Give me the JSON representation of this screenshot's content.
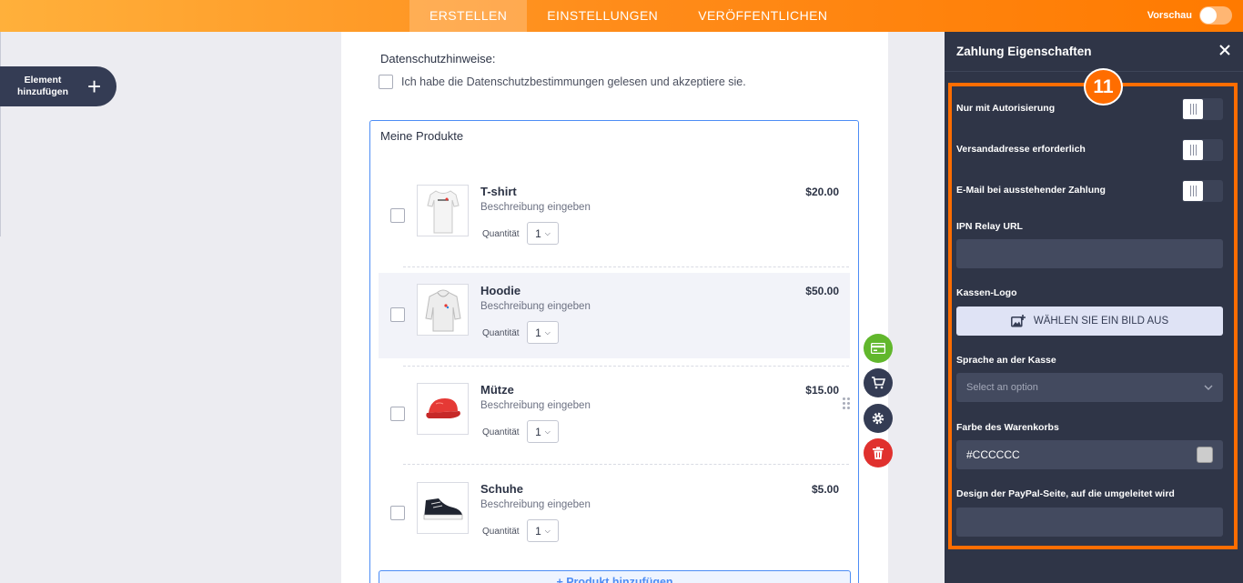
{
  "topbar": {
    "tabs": [
      "ERSTELLEN",
      "EINSTELLUNGEN",
      "VERÖFFENTLICHEN"
    ],
    "active_tab": "ERSTELLEN",
    "preview_label": "Vorschau",
    "preview_enabled": false
  },
  "sidebar": {
    "add_element_label": "Element hinzufügen",
    "add_icon": "plus-icon"
  },
  "form": {
    "privacy_label": "Datenschutzhinweise:",
    "privacy_checkbox_text": "Ich habe die Datenschutzbestimmungen gelesen und akzeptiere sie.",
    "products_title": "Meine Produkte",
    "quantity_label": "Quantität",
    "products": [
      {
        "name": "T-shirt",
        "description": "Beschreibung eingeben",
        "price": "$20.00",
        "quantity": "1",
        "image": "tshirt-image"
      },
      {
        "name": "Hoodie",
        "description": "Beschreibung eingeben",
        "price": "$50.00",
        "quantity": "1",
        "image": "hoodie-image"
      },
      {
        "name": "Mütze",
        "description": "Beschreibung eingeben",
        "price": "$15.00",
        "quantity": "1",
        "image": "cap-image"
      },
      {
        "name": "Schuhe",
        "description": "Beschreibung eingeben",
        "price": "$5.00",
        "quantity": "1",
        "image": "shoe-image"
      }
    ],
    "add_product_label": "+ Produkt hinzufügen"
  },
  "field_actions": [
    "payment-card-icon",
    "cart-icon",
    "gear-icon",
    "trash-icon"
  ],
  "panel": {
    "title": "Zahlung Eigenschaften",
    "step_badge": "11",
    "toggles": [
      {
        "label": "Nur mit Autorisierung",
        "on": false
      },
      {
        "label": "Versandadresse erforderlich",
        "on": false
      },
      {
        "label": "E-Mail bei ausstehender Zahlung",
        "on": false
      }
    ],
    "ipn_label": "IPN Relay URL",
    "ipn_value": "",
    "logo_label": "Kassen-Logo",
    "logo_button": "WÄHLEN SIE EIN BILD AUS",
    "language_label": "Sprache an der Kasse",
    "language_placeholder": "Select an option",
    "cart_color_label": "Farbe des Warenkorbs",
    "cart_color_value": "#CCCCCC",
    "paypal_design_label": "Design der PayPal-Seite, auf die umgeleitet wird",
    "paypal_design_value": ""
  },
  "colors": {
    "accent": "#ff7a00",
    "panel_bg": "#2f3547",
    "highlight": "#ff6d00",
    "link_blue": "#4d8df5"
  }
}
